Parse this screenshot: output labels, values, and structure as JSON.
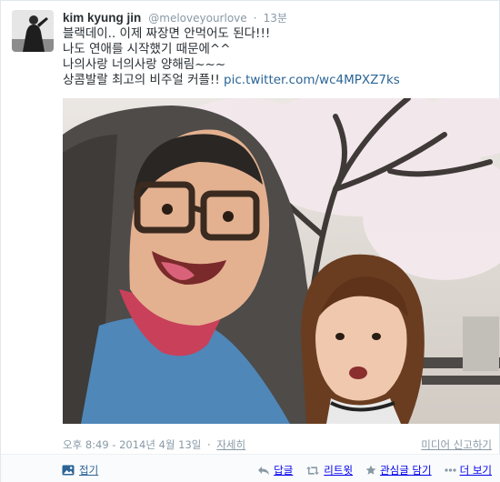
{
  "tweet": {
    "fullname": "kim kyung jin",
    "handle": "@meloveyourlove",
    "separator": "·",
    "time": "13분",
    "lines": [
      "블랙데이.. 이제 짜장면 안먹어도 된다!!!",
      "나도 연애를 시작했기 때문에^^",
      "나의사랑 너의사랑 양해림~~~",
      "상콤발랄 최고의 비주얼 커플!!"
    ],
    "link": "pic.twitter.com/wc4MPXZ7ks",
    "timestamp": "오후 8:49 - 2014년 4월 13일",
    "meta_sep": "·",
    "detail": "자세히",
    "report": "미디어 신고하기",
    "collapse": "접기"
  },
  "actions": [
    {
      "name": "reply",
      "label": "답글"
    },
    {
      "name": "retweet",
      "label": "리트윗"
    },
    {
      "name": "favorite",
      "label": "관심글 담기"
    },
    {
      "name": "more",
      "label": "더 보기"
    }
  ],
  "icons": {
    "avatar": "profile-photo",
    "collapse": "photo-collapse-icon",
    "reply": "reply-arrow-icon",
    "retweet": "retweet-icon",
    "favorite": "star-icon",
    "more": "ellipsis-icon"
  },
  "colors": {
    "link": "#2a6496",
    "muted": "#8899a6",
    "name": "#292f33"
  }
}
